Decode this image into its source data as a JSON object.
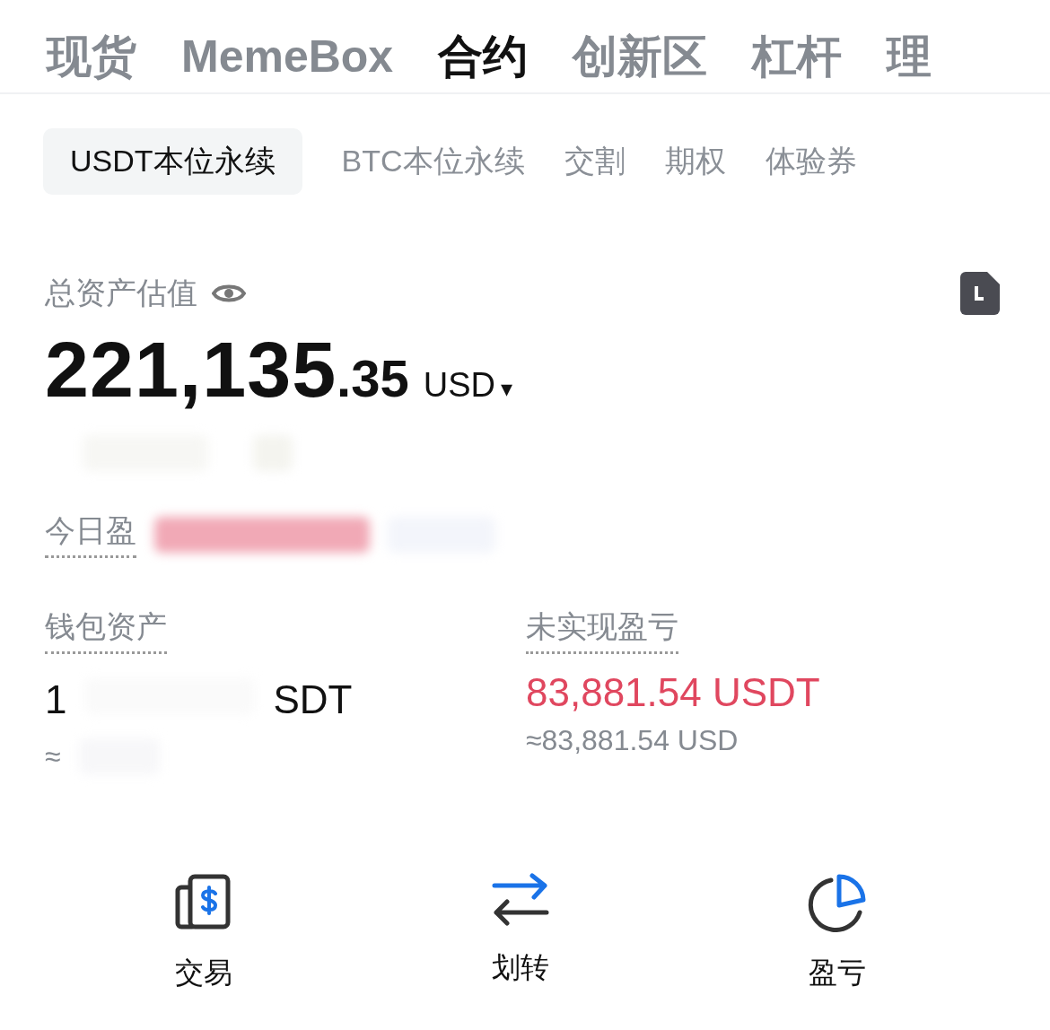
{
  "top_tabs": [
    {
      "label": "现货",
      "selected": false
    },
    {
      "label": "MemeBox",
      "selected": false
    },
    {
      "label": "合约",
      "selected": true
    },
    {
      "label": "创新区",
      "selected": false
    },
    {
      "label": "杠杆",
      "selected": false
    },
    {
      "label": "理",
      "selected": false
    }
  ],
  "sub_tabs": [
    {
      "label": "USDT本位永续",
      "selected": true
    },
    {
      "label": "BTC本位永续",
      "selected": false
    },
    {
      "label": "交割",
      "selected": false
    },
    {
      "label": "期权",
      "selected": false
    },
    {
      "label": "体验券",
      "selected": false
    }
  ],
  "total": {
    "label": "总资产估值",
    "integer": "221,135",
    "decimal": ".35",
    "currency": "USD",
    "caret": "▾"
  },
  "today_pnl": {
    "label": "今日盈"
  },
  "wallet": {
    "label": "钱包资产",
    "value_start": "1",
    "value_end": "SDT",
    "approx": "≈"
  },
  "unrealized": {
    "label": "未实现盈亏",
    "value": "83,881.54 USDT",
    "approx": "≈83,881.54 USD"
  },
  "actions": [
    {
      "kind": "trade",
      "label": "交易"
    },
    {
      "kind": "transfer",
      "label": "划转"
    },
    {
      "kind": "pnl",
      "label": "盈亏"
    }
  ]
}
